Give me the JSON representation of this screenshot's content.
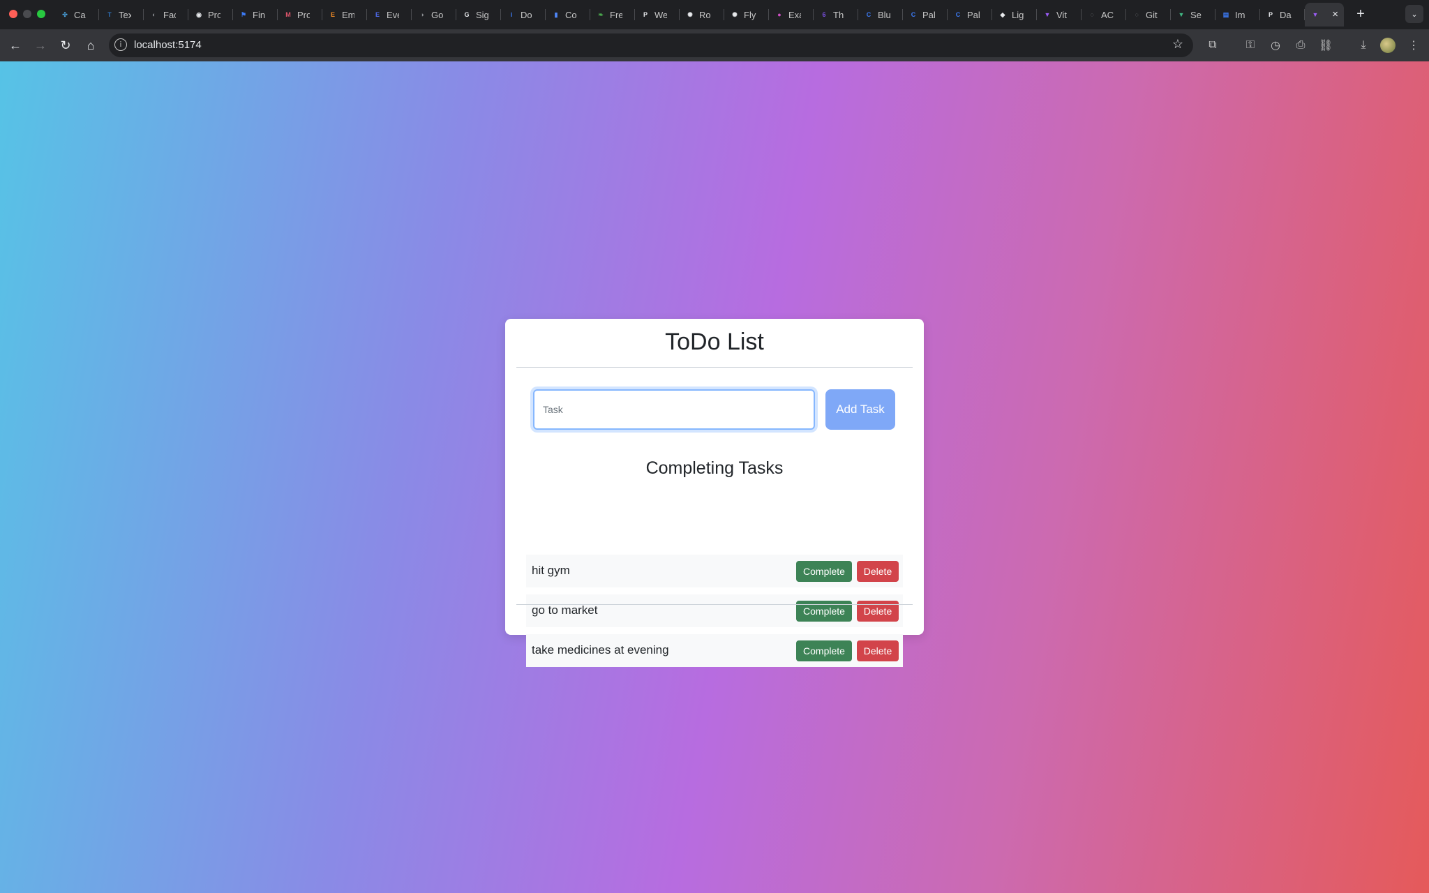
{
  "browser": {
    "tabs": [
      {
        "title": "Ca",
        "icon": "brain-icon",
        "color": "#4aa3df",
        "glyph": "✣"
      },
      {
        "title": "Tex",
        "icon": "typescript-icon",
        "color": "#2f74c0",
        "glyph": "T"
      },
      {
        "title": "Fac",
        "icon": "globe-icon",
        "color": "#8a8d91",
        "glyph": "◐"
      },
      {
        "title": "Pro",
        "icon": "circle-icon",
        "color": "#e8eaed",
        "glyph": "◉"
      },
      {
        "title": "Fin",
        "icon": "flag-icon",
        "color": "#3c7bf6",
        "glyph": "⚑"
      },
      {
        "title": "Pro",
        "icon": "cat-icon",
        "color": "#e0566c",
        "glyph": "M"
      },
      {
        "title": "Em",
        "icon": "brand-icon",
        "color": "#f08a24",
        "glyph": "E"
      },
      {
        "title": "Eve",
        "icon": "brand-icon",
        "color": "#4f6cf0",
        "glyph": "E"
      },
      {
        "title": "Go",
        "icon": "globe-icon",
        "color": "#8a8d91",
        "glyph": "◑"
      },
      {
        "title": "Sig",
        "icon": "google-icon",
        "color": "#e8eaed",
        "glyph": "G"
      },
      {
        "title": "Do",
        "icon": "info-icon",
        "color": "#3c7bf6",
        "glyph": "i"
      },
      {
        "title": "Co",
        "icon": "doc-icon",
        "color": "#4f86f7",
        "glyph": "▮"
      },
      {
        "title": "Fre",
        "icon": "leaf-icon",
        "color": "#4caf50",
        "glyph": "❧"
      },
      {
        "title": "We",
        "icon": "p-icon",
        "color": "#e8eaed",
        "glyph": "P"
      },
      {
        "title": "Ro",
        "icon": "openai-icon",
        "color": "#e8eaed",
        "glyph": "✺"
      },
      {
        "title": "Fly",
        "icon": "openai-icon",
        "color": "#e8eaed",
        "glyph": "✺"
      },
      {
        "title": "Exa",
        "icon": "brand-icon",
        "color": "#d04fc4",
        "glyph": "●"
      },
      {
        "title": "Th",
        "icon": "six-icon",
        "color": "#7a4fe0",
        "glyph": "6"
      },
      {
        "title": "Blu",
        "icon": "brand-icon",
        "color": "#3c7bf6",
        "glyph": "C"
      },
      {
        "title": "Pal",
        "icon": "brand-icon",
        "color": "#3c7bf6",
        "glyph": "C"
      },
      {
        "title": "Pal",
        "icon": "brand-icon",
        "color": "#3c7bf6",
        "glyph": "C"
      },
      {
        "title": "Lig",
        "icon": "brand-icon",
        "color": "#e8eaed",
        "glyph": "◆"
      },
      {
        "title": "Vit",
        "icon": "vite-icon",
        "color": "#9b5cf6",
        "glyph": "▼"
      },
      {
        "title": "AC",
        "icon": "loading-icon",
        "color": "#8a8d91",
        "glyph": "◌"
      },
      {
        "title": "Git",
        "icon": "loading-icon",
        "color": "#8a8d91",
        "glyph": "◌"
      },
      {
        "title": "Se",
        "icon": "vue-icon",
        "color": "#41b883",
        "glyph": "▼"
      },
      {
        "title": "Im",
        "icon": "brand-icon",
        "color": "#3c7bf6",
        "glyph": "▤"
      },
      {
        "title": "Da",
        "icon": "p-icon",
        "color": "#e8eaed",
        "glyph": "P"
      }
    ],
    "active_tab_icon": "vite-icon",
    "url": "localhost:5174"
  },
  "app": {
    "title": "ToDo List",
    "input_placeholder": "Task",
    "input_value": "",
    "add_label": "Add Task",
    "section_title": "Completing Tasks",
    "tasks": [
      {
        "text": "hit gym",
        "complete_label": "Complete",
        "delete_label": "Delete"
      },
      {
        "text": "go to market",
        "complete_label": "Complete",
        "delete_label": "Delete"
      },
      {
        "text": "take medicines at evening",
        "complete_label": "Complete",
        "delete_label": "Delete"
      }
    ]
  },
  "colors": {
    "complete": "#3d8356",
    "delete": "#d2444a",
    "add": "#7fa8f7",
    "gradient": [
      "#56c3e6",
      "#b76ce0",
      "#e55a5a"
    ]
  }
}
